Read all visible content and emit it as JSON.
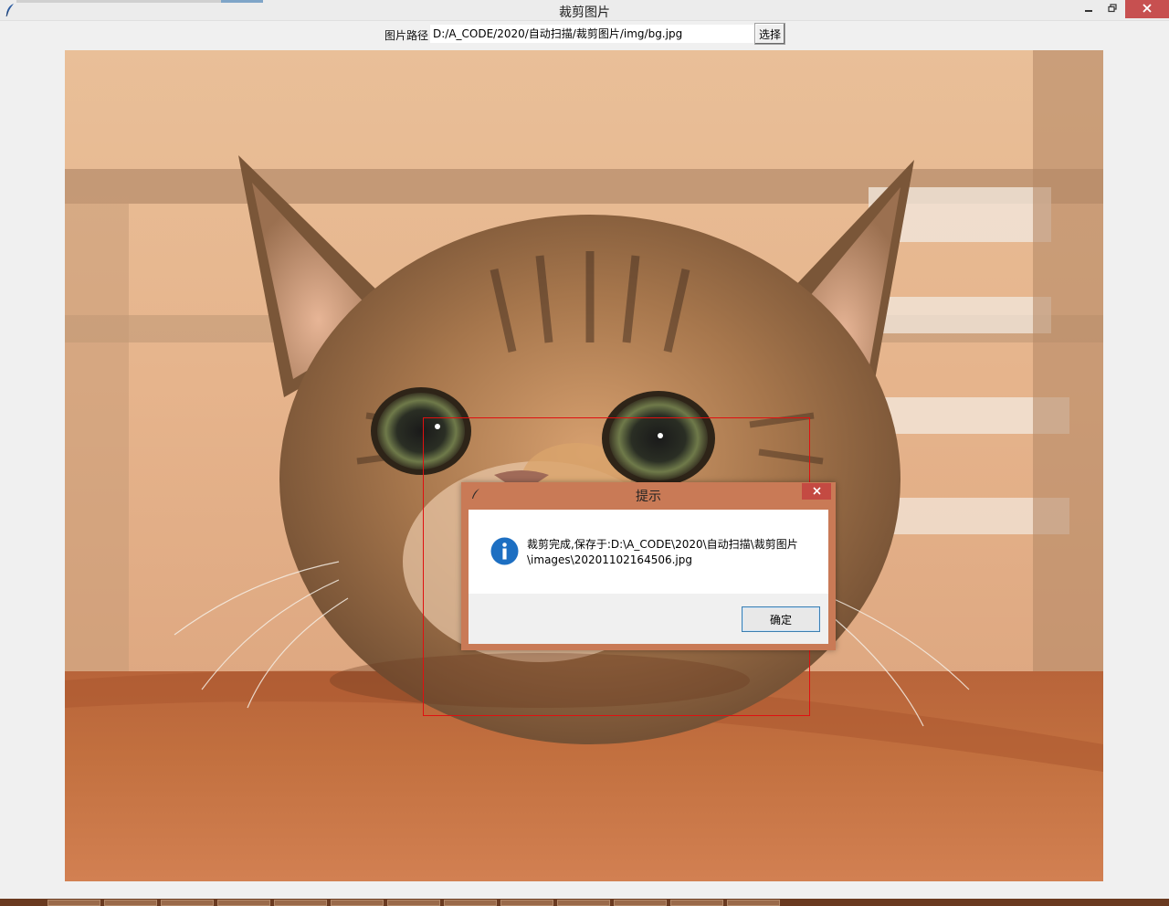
{
  "window": {
    "title": "裁剪图片",
    "minimize_icon": "minimize-icon",
    "restore_icon": "restore-icon",
    "close_icon": "close-icon"
  },
  "path_row": {
    "label": "图片路径",
    "value": "D:/A_CODE/2020/自动扫描/裁剪图片/img/bg.jpg",
    "choose_button": "选择"
  },
  "canvas": {
    "image": "cat-photo",
    "crop_selection_color": "#e01010"
  },
  "dialog": {
    "title": "提示",
    "icon": "info-icon",
    "message_line1": "裁剪完成,保存于:D:\\A_CODE\\2020\\自动扫描\\裁剪图片",
    "message_line2": "\\images\\20201102164506.jpg",
    "ok_button": "确定",
    "frame_color": "#c97a56",
    "close_color": "#c44a42"
  },
  "taskbar": {
    "color": "#6a3a20"
  }
}
